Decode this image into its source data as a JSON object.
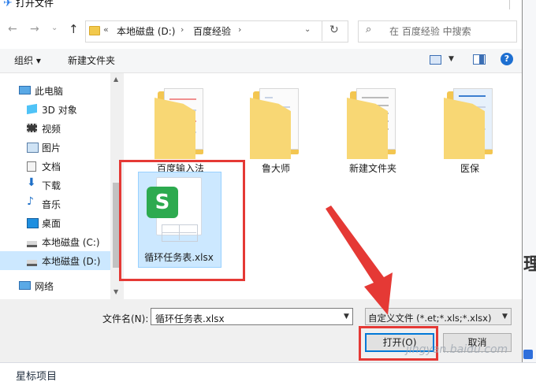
{
  "dialog": {
    "title": "打开文件",
    "nav": {
      "address_segments": [
        "本地磁盘 (D:)",
        "百度经验"
      ],
      "address_overflow": "«",
      "separator": "›",
      "search_placeholder": "在 百度经验 中搜索"
    },
    "toolbar": {
      "organize_label": "组织 ▾",
      "new_folder_label": "新建文件夹",
      "help_label": "?"
    },
    "sidebar": {
      "items": [
        {
          "label": "此电脑",
          "icon": "computer-icon",
          "level": "top"
        },
        {
          "label": "3D 对象",
          "icon": "3d-objects-icon",
          "level": "child"
        },
        {
          "label": "视频",
          "icon": "video-icon",
          "level": "child"
        },
        {
          "label": "图片",
          "icon": "pictures-icon",
          "level": "child"
        },
        {
          "label": "文档",
          "icon": "documents-icon",
          "level": "child"
        },
        {
          "label": "下载",
          "icon": "download-icon",
          "level": "child"
        },
        {
          "label": "音乐",
          "icon": "music-icon",
          "level": "child"
        },
        {
          "label": "桌面",
          "icon": "desktop-icon",
          "level": "child"
        },
        {
          "label": "本地磁盘 (C:)",
          "icon": "drive-icon",
          "level": "child"
        },
        {
          "label": "本地磁盘 (D:)",
          "icon": "drive-icon",
          "level": "child",
          "selected": true
        },
        {
          "label": "网络",
          "icon": "network-icon",
          "level": "top"
        }
      ]
    },
    "files": {
      "folders": [
        "百度输入法",
        "鲁大师",
        "新建文件夹",
        "医保"
      ],
      "selected_file": {
        "name": "循环任务表.xlsx",
        "icon": "wps-spreadsheet-icon",
        "logo_letter": "S"
      }
    },
    "bottom": {
      "filename_label": "文件名(N):",
      "filename_value": "循环任务表.xlsx",
      "filetype_value": "自定义文件 (*.et;*.xls;*.xlsx)",
      "open_label": "打开(O)",
      "cancel_label": "取消"
    }
  },
  "background_app": {
    "bottom_text": "星标项目",
    "right_glyph": "理"
  },
  "watermark": "jingyan.baidu.com",
  "colors": {
    "annotation": "#e53935",
    "selection": "#cce8ff",
    "accent": "#0078d7",
    "folder": "#f3c651",
    "wps_green": "#2daa4f"
  }
}
